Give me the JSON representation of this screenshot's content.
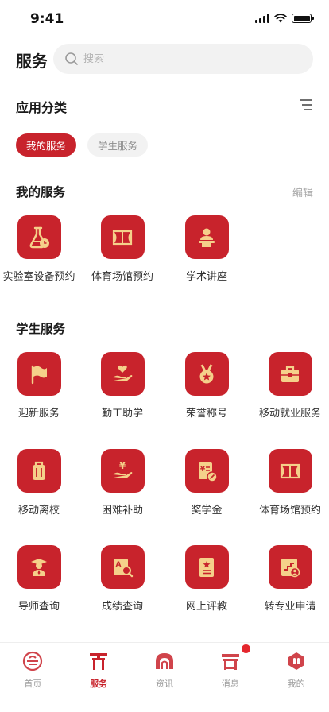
{
  "status_bar": {
    "time": "9:41"
  },
  "header": {
    "title": "服务",
    "search_placeholder": "搜索"
  },
  "category": {
    "title": "应用分类",
    "chips": [
      "我的服务",
      "学生服务"
    ]
  },
  "my_services": {
    "title": "我的服务",
    "edit_label": "编辑",
    "items": [
      {
        "label": "实验室设备预约",
        "icon": "flask-icon"
      },
      {
        "label": "体育场馆预约",
        "icon": "stadium-icon"
      },
      {
        "label": "学术讲座",
        "icon": "lecture-icon"
      }
    ]
  },
  "student_services": {
    "title": "学生服务",
    "items": [
      {
        "label": "迎新服务",
        "icon": "flag-icon"
      },
      {
        "label": "勤工助学",
        "icon": "hand-heart-icon"
      },
      {
        "label": "荣誉称号",
        "icon": "medal-icon"
      },
      {
        "label": "移动就业服务",
        "icon": "briefcase-icon"
      },
      {
        "label": "移动离校",
        "icon": "luggage-icon"
      },
      {
        "label": "困难补助",
        "icon": "hand-coin-icon"
      },
      {
        "label": "奖学金",
        "icon": "scholarship-icon"
      },
      {
        "label": "体育场馆预约",
        "icon": "stadium-icon"
      },
      {
        "label": "导师查询",
        "icon": "mentor-icon"
      },
      {
        "label": "成绩查询",
        "icon": "grade-search-icon"
      },
      {
        "label": "网上评教",
        "icon": "evaluation-icon"
      },
      {
        "label": "转专业申请",
        "icon": "transfer-icon"
      }
    ]
  },
  "bottom_nav": {
    "items": [
      {
        "label": "首页",
        "icon": "home-icon",
        "active": false
      },
      {
        "label": "服务",
        "icon": "service-icon",
        "active": true
      },
      {
        "label": "资讯",
        "icon": "news-icon",
        "active": false
      },
      {
        "label": "消息",
        "icon": "message-icon",
        "active": false,
        "badge": true
      },
      {
        "label": "我的",
        "icon": "profile-icon",
        "active": false
      }
    ]
  },
  "colors": {
    "accent": "#c8232c",
    "icon_gold": "#f5d08a",
    "badge": "#e4262d"
  }
}
